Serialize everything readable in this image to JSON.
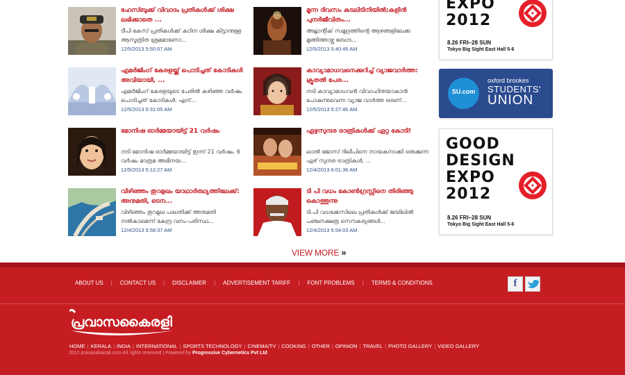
{
  "news": [
    {
      "title": "ഹേസ്ബുക്ക് വിവാദം പ്രതികൾക്ക് ശിക്ഷ ലഭിക്കാതെ ...",
      "desc": "ടീപി കേസ് പ്രതികൾക്ക് കഠിന ശിക്ഷ കിട്ടാനുള്ള ആസൂത്രിത ശ്രമമാണോ...",
      "date": "12/5/2013 5:50:57 AM",
      "thumb": "police-officer-photo"
    },
    {
      "title": "മൂന്ന ദിവസം കടലിടിനിയിൽ;കളിൻ പുനർജീവിതം...",
      "desc": "അറ്റ്ലാന്റിക് സമുദ്രത്തിന്റെ ആഴങ്ങളിലേക്ക മുങ്ങിത്താഴ്ന്നു ബോട...",
      "date": "12/5/2013 5:40:45 AM",
      "thumb": "diver-photo"
    },
    {
      "title": "എമർജിംഗ് കേരളയ്ക്ക് പൊടിച്ചത് കോടികൾ അവിയായി, ...",
      "desc": "എമർജിംഗ് കേരളയുടെ പേരിൽ കഴിഞ്ഞ വർഷം പൊടിച്ചത് കോടികൾ. എന്...",
      "date": "12/5/2013 5:31:05 AM",
      "thumb": "stage-event-photo"
    },
    {
      "title": "കാവ്യാമാധവനെക്കുറിച്ച് വ്യാജവാർത്ത: ക്രൂതൽ പേര...",
      "desc": "നടി കാവ്യാമാധവൻ വിവാഹിതയാകാൻ പോകുന്നുവെന്ന വ്യാജ വാർത്ത ഒരണ്...",
      "date": "12/5/2013 5:27:46 AM",
      "thumb": "actress-bride-photo"
    },
    {
      "title": "മോനിഷ ഓർമ്മയായിട്ട് 21 വർഷം",
      "desc": "നടി മോനിഷ ഓർമ്മയായിട്ട് ഇന്ന് 21 വർഷം. 6 വർഷം മാത്രമ അഭിനയ...",
      "date": "12/5/2013 5:12:27 AM",
      "thumb": "actress-portrait-photo"
    },
    {
      "title": "ഏഴുസുന്ദര രാത്രികൾക്ക് ഏറ്റ കോടി!",
      "desc": "ലാൽ ജോസ് ദിലീപിനെ നായകനാക്കി ഒരുക്കുന്ന ഏഴ് സുന്ദര രാത്രികൾ, ...",
      "date": "12/4/2013 6:01:36 AM",
      "thumb": "movie-poster-photo"
    },
    {
      "title": "വിഴിഞ്ഞം തുറമുഖം യാഥാർത്ഥ്യത്തിലേക്ക്: അനുമതി, ടെന...",
      "desc": "വിഴിഞ്ഞം തുറമുഖ പദ്ധതിക്ക് അനുമതി നൽകാമെന്ന് കേന്ദ്ര വനം-പരിസ്ഥ...",
      "date": "12/4/2013 5:58:37 AM",
      "thumb": "harbour-aerial-photo"
    },
    {
      "title": "ടി പി വധം കോൺഗ്രസ്സിനെ തിരിഞ്ഞു കൊത്തുന്നു",
      "desc": "ടി.പി വധക്കേസിലെ പ്രതികൾക്ക് ജയിലിൽ പഞ്ചനക്ഷത്ര സൌകര്യങ്ങൾ...",
      "date": "12/4/2013 5:54:03 AM",
      "thumb": "politician-photo"
    }
  ],
  "ads": {
    "expo_top": {
      "line1": "EXPO",
      "line2": "2012",
      "date": "8.26 FRI–28 SUN",
      "venue": "Tokyo Big Sight East Hall 5-6"
    },
    "union": {
      "top": "oxford brookes",
      "mid": "STUDENTS'",
      "bottom": "UNION",
      "badge": "SU.com"
    },
    "expo": {
      "line1": "GOOD",
      "line2": "DESIGN",
      "line3": "EXPO",
      "line4": "2012",
      "date": "8.26 FRI–28 SUN",
      "venue": "Tokyo Big Sight East Hall 5-6"
    }
  },
  "view_more": {
    "label": "VIEW MORE",
    "arrow": "»"
  },
  "footer": {
    "nav": [
      "ABOUT US",
      "CONTACT US",
      "DISCLAIMER",
      "ADVERTISEMENT TARIFF",
      "FONT PROBLEMS",
      "TERMS & CONDITIONS"
    ],
    "social": [
      "f",
      "t"
    ],
    "logo_text": "പ്രവാസകൈരളി",
    "links": [
      "HOME",
      "KERALA",
      "INDIA",
      "INTERNATIONAL",
      "SPORTS  TECHNOLOGY",
      "CINEMA/TV",
      "COOKING",
      "OTHER",
      "OPINION",
      "TRAVEL",
      "PHOTO GALLERY",
      "VIDEO GALLERY"
    ],
    "copyright": "2012 pravasakairali.com All rights reserved | Powered by",
    "powered_by": "Progressive Cybernetics Pvt Ltd"
  },
  "colors": {
    "accent": "#c4171f",
    "footer": "#c51d22",
    "date": "#2a4f84"
  }
}
